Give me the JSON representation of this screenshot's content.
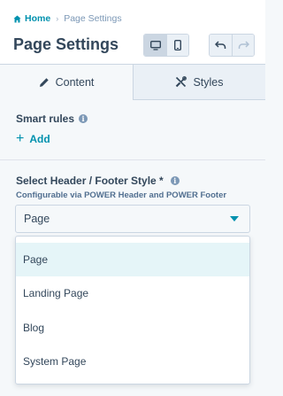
{
  "breadcrumb": {
    "home": "Home",
    "current": "Page Settings"
  },
  "header": {
    "title": "Page Settings"
  },
  "tabs": [
    {
      "label": "Content",
      "icon": "pencil-icon",
      "active": true
    },
    {
      "label": "Styles",
      "icon": "tools-icon",
      "active": false
    }
  ],
  "smart_rules": {
    "label": "Smart rules",
    "add_label": "Add"
  },
  "header_footer": {
    "label": "Select Header / Footer Style *",
    "help": "Configurable via POWER Header and POWER Footer",
    "selected": "Page",
    "options": [
      "Page",
      "Landing Page",
      "Blog",
      "System Page"
    ]
  },
  "colors": {
    "accent": "#0091ae",
    "text": "#33475b",
    "selected_option_bg": "#e5f5f8"
  }
}
